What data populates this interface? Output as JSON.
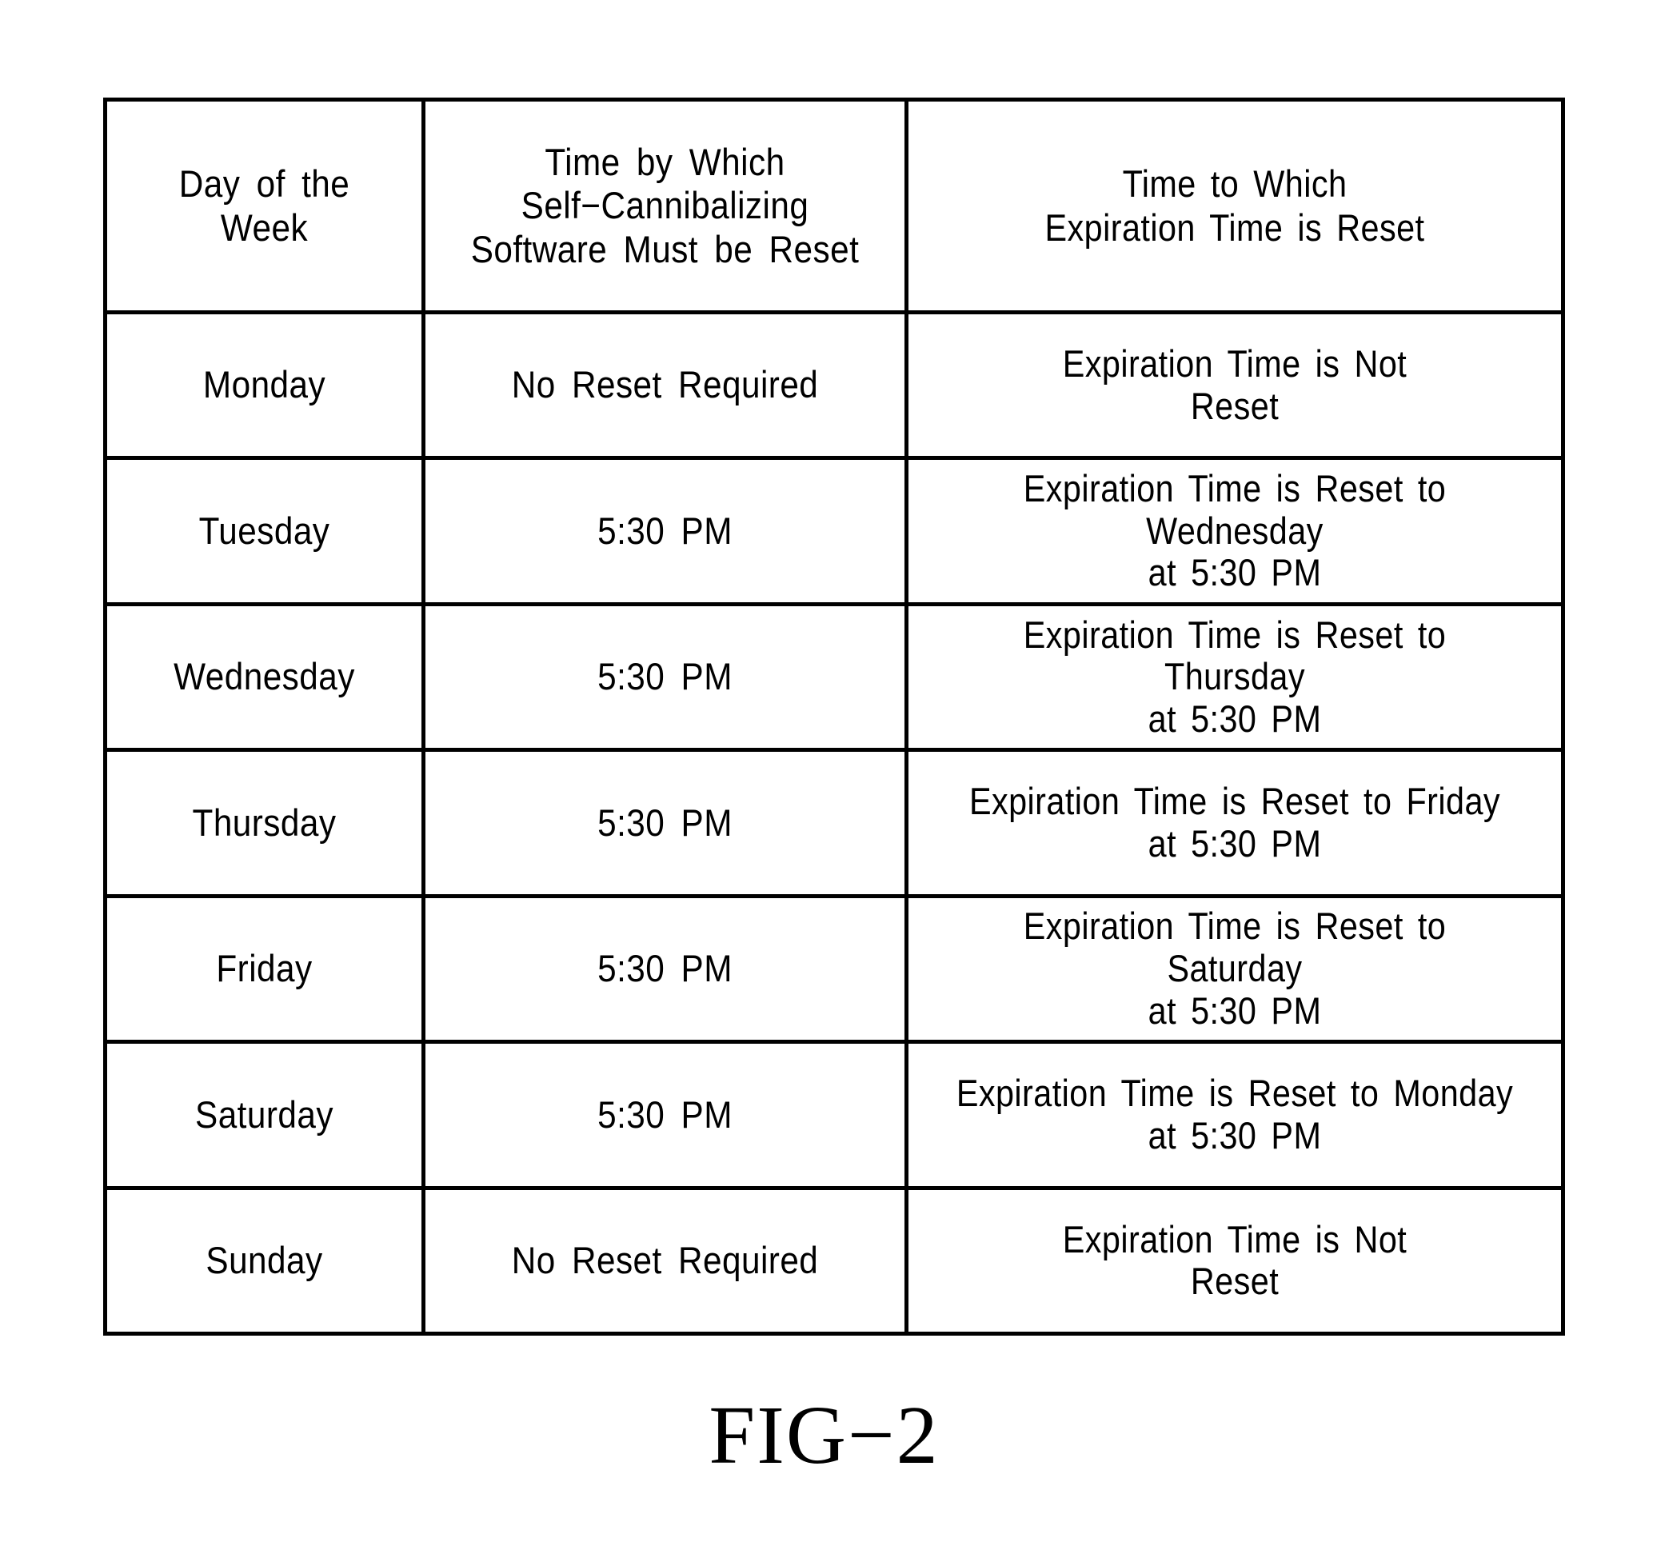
{
  "figure": {
    "caption": "FIG−2",
    "colors": {
      "ink": "#000000",
      "background": "#ffffff"
    }
  },
  "table": {
    "headers": {
      "col1": "Day of the Week",
      "col2": "Time by Which\nSelf−Cannibalizing\nSoftware Must be Reset",
      "col3": "Time to Which\nExpiration Time is Reset"
    },
    "rows": [
      {
        "day": "Monday",
        "reset_by": "No Reset Required",
        "reset_to": "Expiration Time is Not\nReset"
      },
      {
        "day": "Tuesday",
        "reset_by": "5:30 PM",
        "reset_to": "Expiration Time is Reset to Wednesday\nat 5:30 PM"
      },
      {
        "day": "Wednesday",
        "reset_by": "5:30 PM",
        "reset_to": "Expiration Time is Reset to Thursday\nat 5:30 PM"
      },
      {
        "day": "Thursday",
        "reset_by": "5:30 PM",
        "reset_to": "Expiration Time is Reset to Friday\nat 5:30 PM"
      },
      {
        "day": "Friday",
        "reset_by": "5:30 PM",
        "reset_to": "Expiration Time is Reset to Saturday\nat 5:30 PM"
      },
      {
        "day": "Saturday",
        "reset_by": "5:30 PM",
        "reset_to": "Expiration Time is Reset to Monday\nat 5:30 PM"
      },
      {
        "day": "Sunday",
        "reset_by": "No Reset Required",
        "reset_to": "Expiration Time is Not\nReset"
      }
    ]
  }
}
